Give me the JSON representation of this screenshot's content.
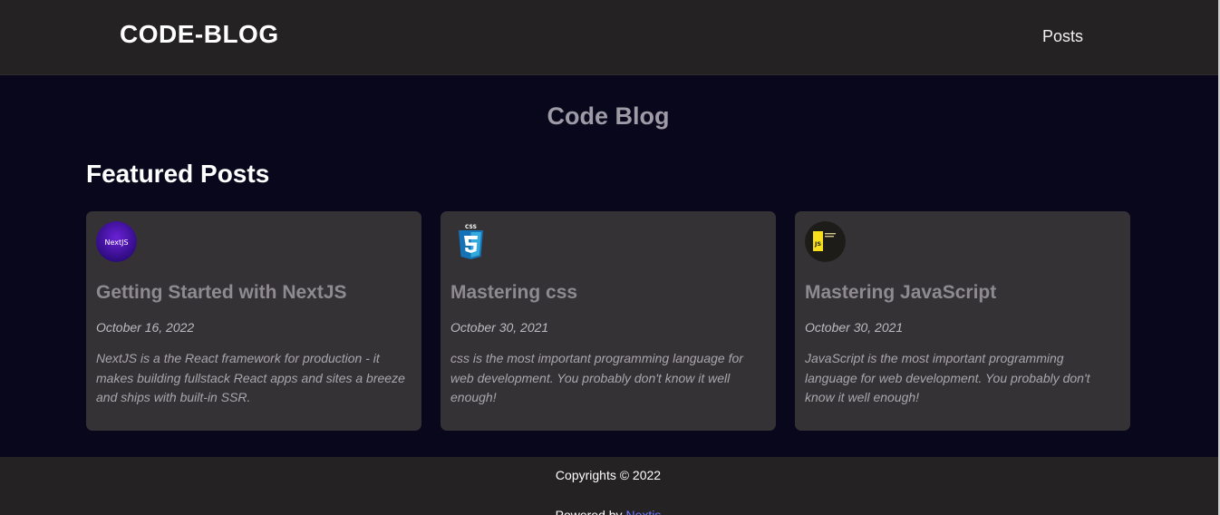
{
  "header": {
    "logo": "CODE-BLOG",
    "nav": [
      {
        "label": "Posts"
      }
    ]
  },
  "main": {
    "site_title": "Code Blog",
    "section_title": "Featured Posts"
  },
  "posts": [
    {
      "icon": "nextjs-logo-icon",
      "icon_text": "NextJS",
      "title": "Getting Started with NextJS",
      "date": "October 16, 2022",
      "excerpt": "NextJS is a the React framework for production - it makes building fullstack React apps and sites a breeze and ships with built-in SSR."
    },
    {
      "icon": "css3-logo-icon",
      "icon_text": "CSS",
      "title": "Mastering css",
      "date": "October 30, 2021",
      "excerpt": "css is the most important programming language for web development. You probably don't know it well enough!"
    },
    {
      "icon": "javascript-logo-icon",
      "icon_text": "JS",
      "title": "Mastering JavaScript",
      "date": "October 30, 2021",
      "excerpt": "JavaScript is the most important programming language for web development. You probably don't know it well enough!"
    }
  ],
  "footer": {
    "copyright": "Copyrights © 2022",
    "powered_prefix": "Powered by ",
    "powered_link": "Nextjs"
  },
  "colors": {
    "page_bg": "#08071b",
    "header_bg": "#242223",
    "card_bg": "#353236",
    "link": "#6f7dff"
  }
}
